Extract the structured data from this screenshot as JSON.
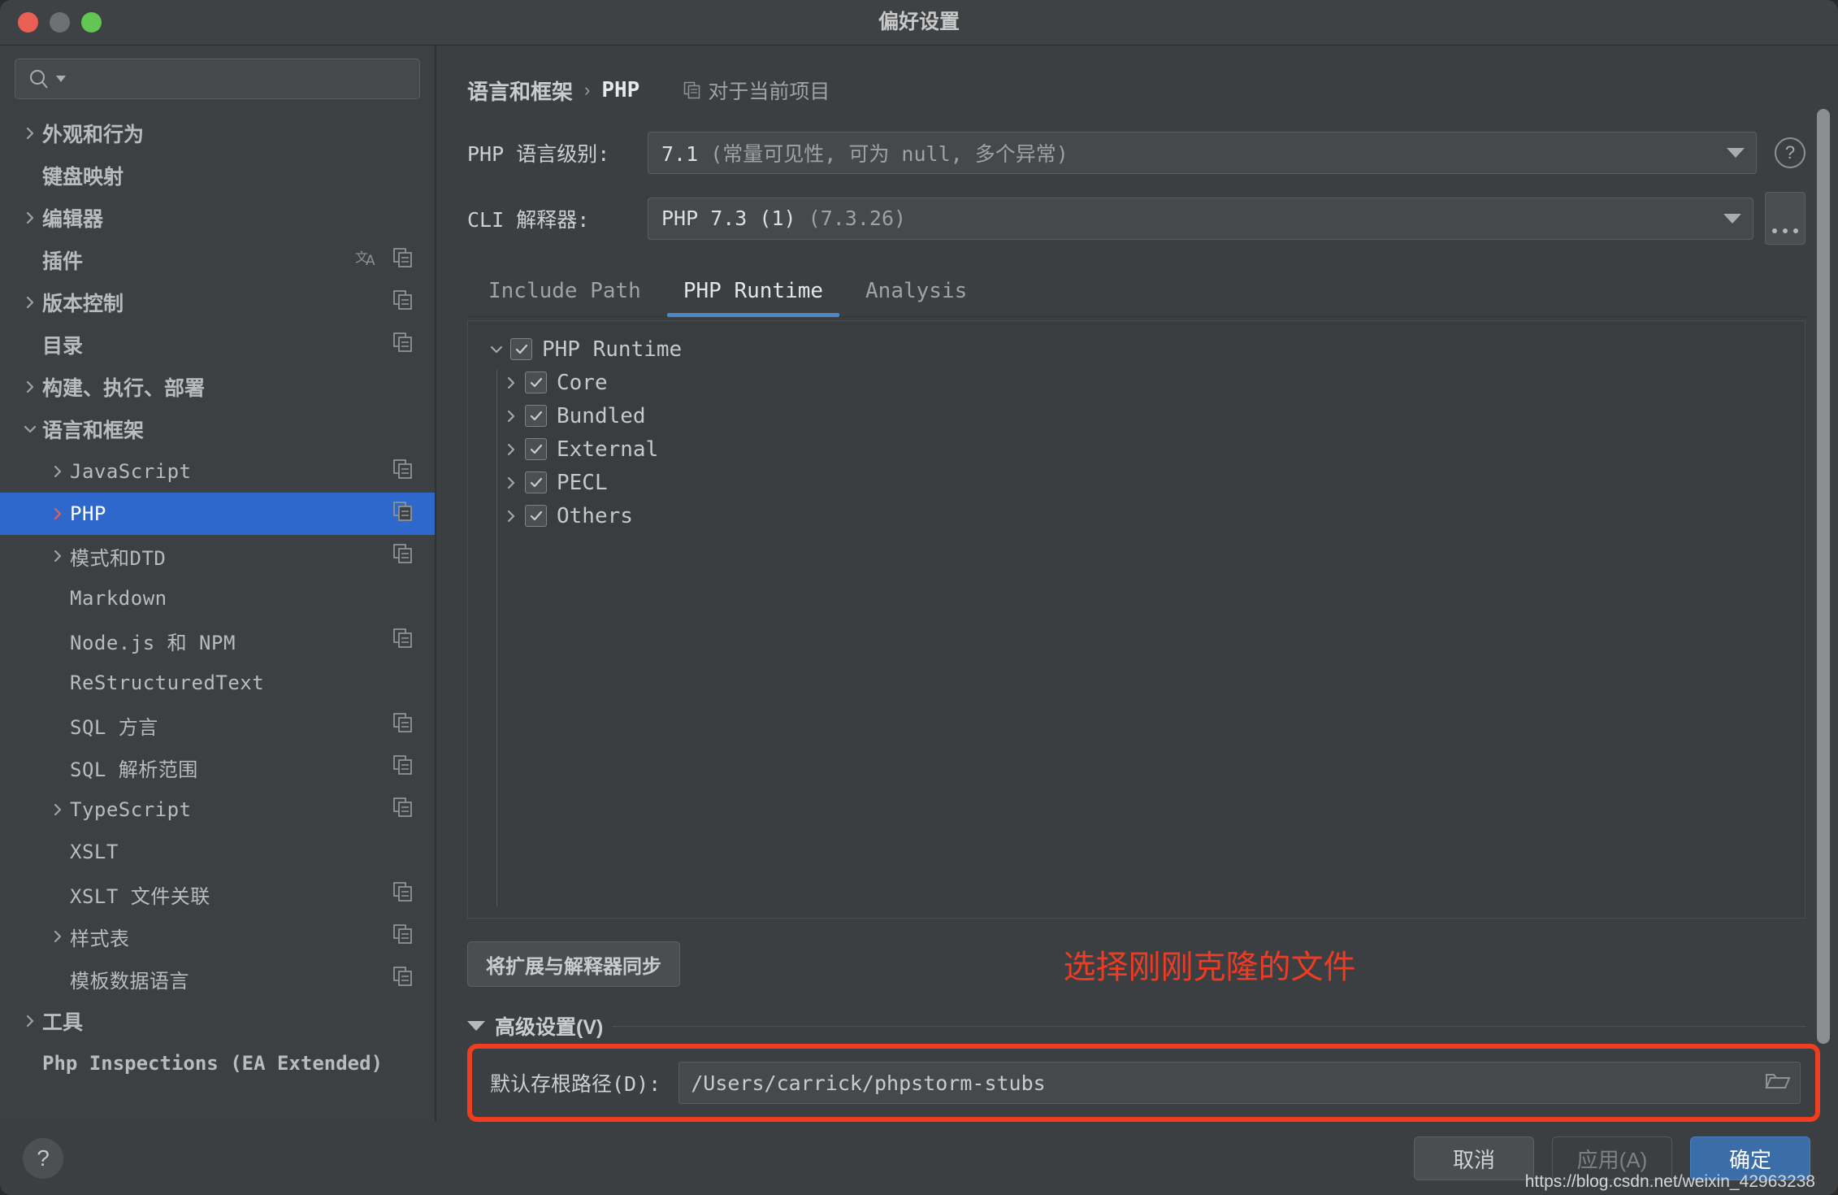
{
  "window": {
    "title": "偏好设置",
    "traffic": [
      "close",
      "minimize",
      "zoom"
    ]
  },
  "sidebar": {
    "search": {
      "placeholder": "",
      "value": "",
      "icon": "search-icon"
    },
    "items": [
      {
        "label": "外观和行为",
        "level": 0,
        "chevron": "right",
        "script": "cjk",
        "actions": []
      },
      {
        "label": "键盘映射",
        "level": 0,
        "chevron": "none",
        "script": "cjk",
        "actions": []
      },
      {
        "label": "编辑器",
        "level": 0,
        "chevron": "right",
        "script": "cjk",
        "actions": []
      },
      {
        "label": "插件",
        "level": 0,
        "chevron": "none",
        "script": "cjk",
        "actions": [
          "translate-icon",
          "copy-icon"
        ]
      },
      {
        "label": "版本控制",
        "level": 0,
        "chevron": "right",
        "script": "cjk",
        "actions": [
          "copy-icon"
        ]
      },
      {
        "label": "目录",
        "level": 0,
        "chevron": "none",
        "script": "cjk",
        "actions": [
          "copy-icon"
        ]
      },
      {
        "label": "构建、执行、部署",
        "level": 0,
        "chevron": "right",
        "script": "cjk",
        "actions": []
      },
      {
        "label": "语言和框架",
        "level": 0,
        "chevron": "down",
        "script": "cjk",
        "actions": []
      },
      {
        "label": "JavaScript",
        "level": 1,
        "chevron": "right",
        "script": "mono",
        "actions": [
          "copy-icon"
        ]
      },
      {
        "label": "PHP",
        "level": 1,
        "chevron": "right",
        "script": "mono",
        "selected": true,
        "actions": [
          "copy-icon"
        ]
      },
      {
        "label": "模式和DTD",
        "level": 1,
        "chevron": "right",
        "script": "mono",
        "actions": [
          "copy-icon"
        ]
      },
      {
        "label": "Markdown",
        "level": 1,
        "chevron": "none",
        "script": "mono",
        "actions": []
      },
      {
        "label": "Node.js 和 NPM",
        "level": 1,
        "chevron": "none",
        "script": "mono",
        "actions": [
          "copy-icon"
        ]
      },
      {
        "label": "ReStructuredText",
        "level": 1,
        "chevron": "none",
        "script": "mono",
        "actions": []
      },
      {
        "label": "SQL 方言",
        "level": 1,
        "chevron": "none",
        "script": "mono",
        "actions": [
          "copy-icon"
        ]
      },
      {
        "label": "SQL 解析范围",
        "level": 1,
        "chevron": "none",
        "script": "mono",
        "actions": [
          "copy-icon"
        ]
      },
      {
        "label": "TypeScript",
        "level": 1,
        "chevron": "right",
        "script": "mono",
        "actions": [
          "copy-icon"
        ]
      },
      {
        "label": "XSLT",
        "level": 1,
        "chevron": "none",
        "script": "mono",
        "actions": []
      },
      {
        "label": "XSLT 文件关联",
        "level": 1,
        "chevron": "none",
        "script": "mono",
        "actions": [
          "copy-icon"
        ]
      },
      {
        "label": "样式表",
        "level": 1,
        "chevron": "right",
        "script": "mono",
        "actions": [
          "copy-icon"
        ]
      },
      {
        "label": "模板数据语言",
        "level": 1,
        "chevron": "none",
        "script": "mono",
        "actions": [
          "copy-icon"
        ]
      },
      {
        "label": "工具",
        "level": 0,
        "chevron": "right",
        "script": "cjk",
        "actions": []
      },
      {
        "label": "Php Inspections (EA Extended)",
        "level": 0,
        "chevron": "none",
        "script": "bold-latin",
        "actions": []
      }
    ]
  },
  "main": {
    "breadcrumb": {
      "parent": "语言和框架",
      "separator": "›",
      "current": "PHP",
      "scope_icon": "copy-icon",
      "scope_label": "对于当前项目"
    },
    "language_level": {
      "label": "PHP 语言级别:",
      "value_strong": "7.1",
      "value_dim": "(常量可见性, 可为 null, 多个异常)",
      "help_icon": "question-mark-icon"
    },
    "cli_interpreter": {
      "label": "CLI 解释器:",
      "value_strong": "PHP 7.3 (1)",
      "value_dim": "(7.3.26)",
      "more_button": "…"
    },
    "tabs": [
      {
        "label": "Include Path",
        "active": false
      },
      {
        "label": "PHP Runtime",
        "active": true
      },
      {
        "label": "Analysis",
        "active": false
      }
    ],
    "runtime_tree": [
      {
        "label": "PHP Runtime",
        "chevron": "down",
        "checked": true,
        "child": false
      },
      {
        "label": "Core",
        "chevron": "right",
        "checked": true,
        "child": true
      },
      {
        "label": "Bundled",
        "chevron": "right",
        "checked": true,
        "child": true
      },
      {
        "label": "External",
        "chevron": "right",
        "checked": true,
        "child": true
      },
      {
        "label": "PECL",
        "chevron": "right",
        "checked": true,
        "child": true
      },
      {
        "label": "Others",
        "chevron": "right",
        "checked": true,
        "child": true
      }
    ],
    "sync_button": "将扩展与解释器同步",
    "annotation": "选择刚刚克隆的文件",
    "advanced": {
      "label": "高级设置(V)",
      "expanded": true
    },
    "default_root": {
      "label": "默认存根路径(D):",
      "value": "/Users/carrick/phpstorm-stubs",
      "browse_icon": "folder-icon"
    }
  },
  "footer": {
    "help_icon": "question-mark-icon",
    "cancel": "取消",
    "apply": "应用(A)",
    "ok": "确定",
    "watermark": "https://blog.csdn.net/weixin_42963238"
  },
  "colors": {
    "accent_blue": "#2f68cd",
    "tab_underline": "#4b88c7",
    "annotation_red": "#ee3b24",
    "highlight_border_red": "#f03c20",
    "ok_button": "#3b6ea8",
    "selected_chevron": "#e8604c"
  }
}
